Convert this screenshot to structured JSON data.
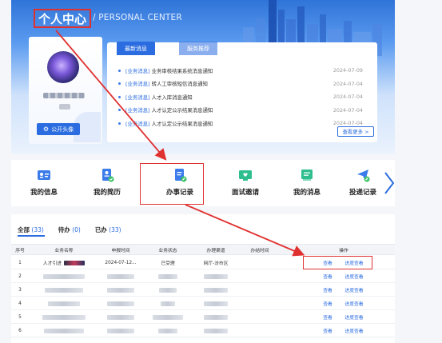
{
  "header": {
    "title_cn": "个人中心",
    "title_en": "/ PERSONAL CENTER"
  },
  "profile": {
    "public_avatar_label": "公开头像"
  },
  "notices": {
    "tabs": [
      {
        "label": "最新消息",
        "active": true
      },
      {
        "label": "服务推荐",
        "active": false
      }
    ],
    "items": [
      {
        "category": "[业务消息]",
        "text": "业务审核结果系统消息通知",
        "date": "2024-07-09"
      },
      {
        "category": "[业务消息]",
        "text": "转人工审核短信消息通知",
        "date": "2024-07-04"
      },
      {
        "category": "[业务消息]",
        "text": "人才入库消息通知",
        "date": "2024-07-04"
      },
      {
        "category": "[业务消息]",
        "text": "人才认定公示结果消息通知",
        "date": "2024-07-04"
      },
      {
        "category": "[业务消息]",
        "text": "人才认定公示结果消息通知",
        "date": "2024-07-04"
      }
    ],
    "more_label": "查看更多 >"
  },
  "nav": {
    "items": [
      {
        "label": "我的信息",
        "icon": "id-card-icon"
      },
      {
        "label": "我的简历",
        "icon": "resume-icon"
      },
      {
        "label": "办事记录",
        "icon": "records-icon"
      },
      {
        "label": "面试邀请",
        "icon": "interview-icon"
      },
      {
        "label": "我的消息",
        "icon": "message-icon"
      },
      {
        "label": "投递记录",
        "icon": "delivery-icon"
      }
    ],
    "next_icon": "chevron-right-icon"
  },
  "records": {
    "status_tabs": [
      {
        "label": "全部",
        "count": "(33)"
      },
      {
        "label": "待办",
        "count": "(0)"
      },
      {
        "label": "已办",
        "count": "(33)"
      }
    ],
    "columns": [
      "序号",
      "业务名称",
      "申报时间",
      "业务状态",
      "办理渠道",
      "办结时间",
      "操作"
    ],
    "first_row": {
      "index": "1",
      "business_name": "人才引进",
      "apply_time": "2024-07-12...",
      "status": "已受理",
      "channel": "网厅-汾市区",
      "finish_time": ""
    },
    "row_indexes": [
      "2",
      "3",
      "4",
      "5",
      "6"
    ],
    "view_label": "查看",
    "progress_label": "进度查看"
  },
  "colors": {
    "brand": "#2b6de0",
    "highlight": "#e03131"
  }
}
